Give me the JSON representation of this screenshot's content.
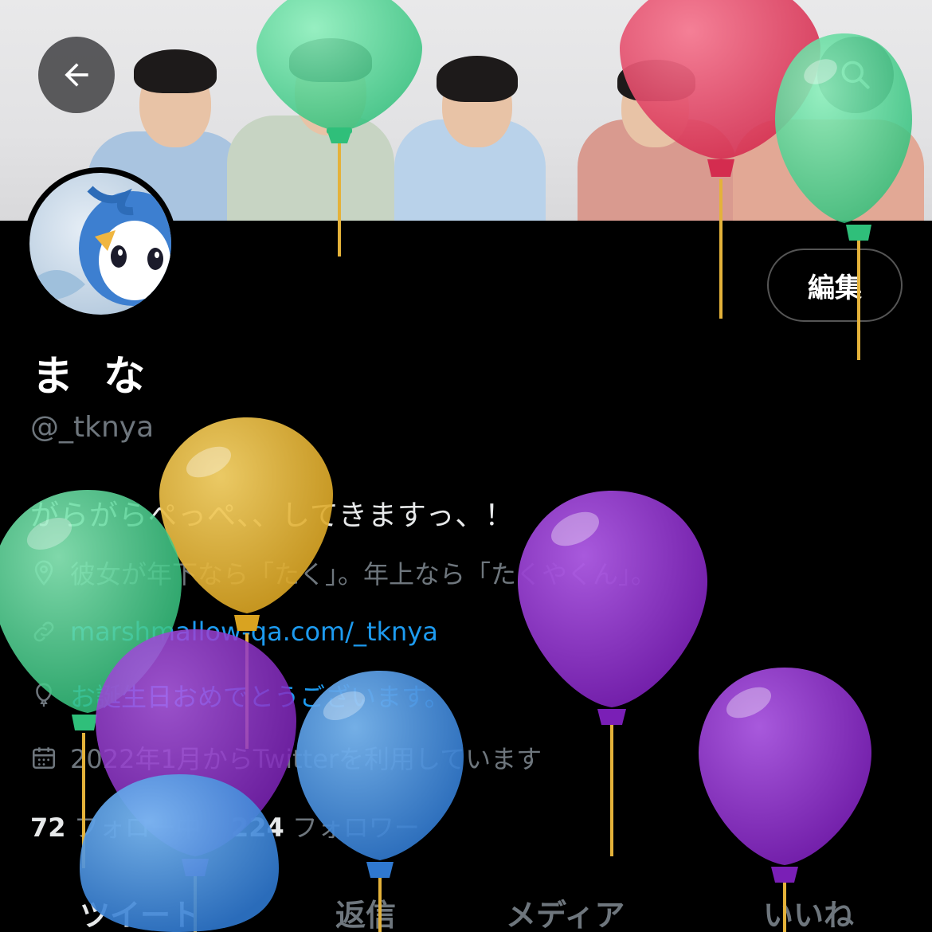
{
  "header": {
    "back_icon": "arrow-left-icon",
    "search_icon": "search-icon"
  },
  "profile": {
    "name": "ま な",
    "handle": "@_tknya",
    "edit_label": "編集",
    "bio": "がらがらぺっぺ、、してきますっ、！",
    "location": "彼女が年下なら「たく」。年上なら「たくやくん」。",
    "website": "marshmallow-qa.com/_tknya",
    "birthday": "お誕生日おめでとうございます。",
    "joined": "2022年1月からTwitterを利用しています",
    "following_count": "72",
    "following_label": "フォロー中",
    "followers_count": "224",
    "followers_label": "フォロワー"
  },
  "tabs": [
    {
      "label": "ツイート"
    },
    {
      "label": "返信"
    },
    {
      "label": "メディア"
    },
    {
      "label": "いいね"
    }
  ],
  "colors": {
    "link": "#1d9bf0",
    "muted": "#6e767d",
    "balloon_green": "#5fd69a",
    "balloon_red": "#e64a67",
    "balloon_yellow": "#e8b83a",
    "balloon_purple": "#8a2fc4",
    "balloon_blue": "#4a8fdb"
  }
}
